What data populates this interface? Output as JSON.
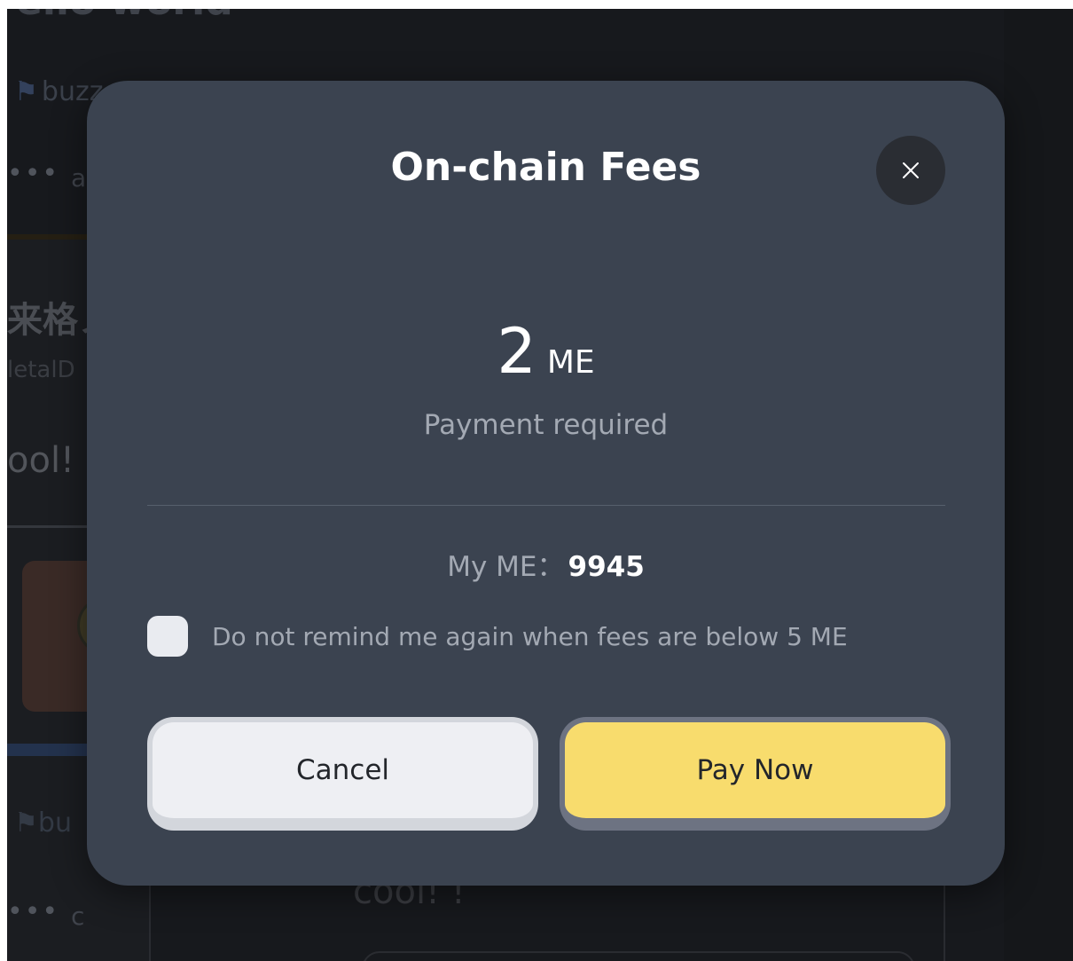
{
  "background": {
    "title": "ello world",
    "buzz_label": "buzz",
    "dots": "•••",
    "letter_a": "a",
    "cjk_text": "来格ノ",
    "metal_text": "letalD",
    "cool_text": "ool!",
    "buzz_label_2": "bu",
    "letter_c": "c",
    "cool_text_2": "cool! !"
  },
  "modal": {
    "title": "On-chain Fees",
    "amount_value": "2",
    "amount_unit": "ME",
    "payment_label": "Payment required",
    "balance_label": "My ME：",
    "balance_value": "9945",
    "checkbox_label": "Do not remind me again when fees are below 5 ME",
    "cancel_label": "Cancel",
    "pay_label": "Pay Now"
  },
  "colors": {
    "modal_bg": "#3b4350",
    "pay_button": "#f8dc6d",
    "cancel_button": "#eeeff3",
    "close_button": "#2a2d33"
  },
  "icons": {
    "close": "close-icon",
    "flag": "flag-icon"
  }
}
